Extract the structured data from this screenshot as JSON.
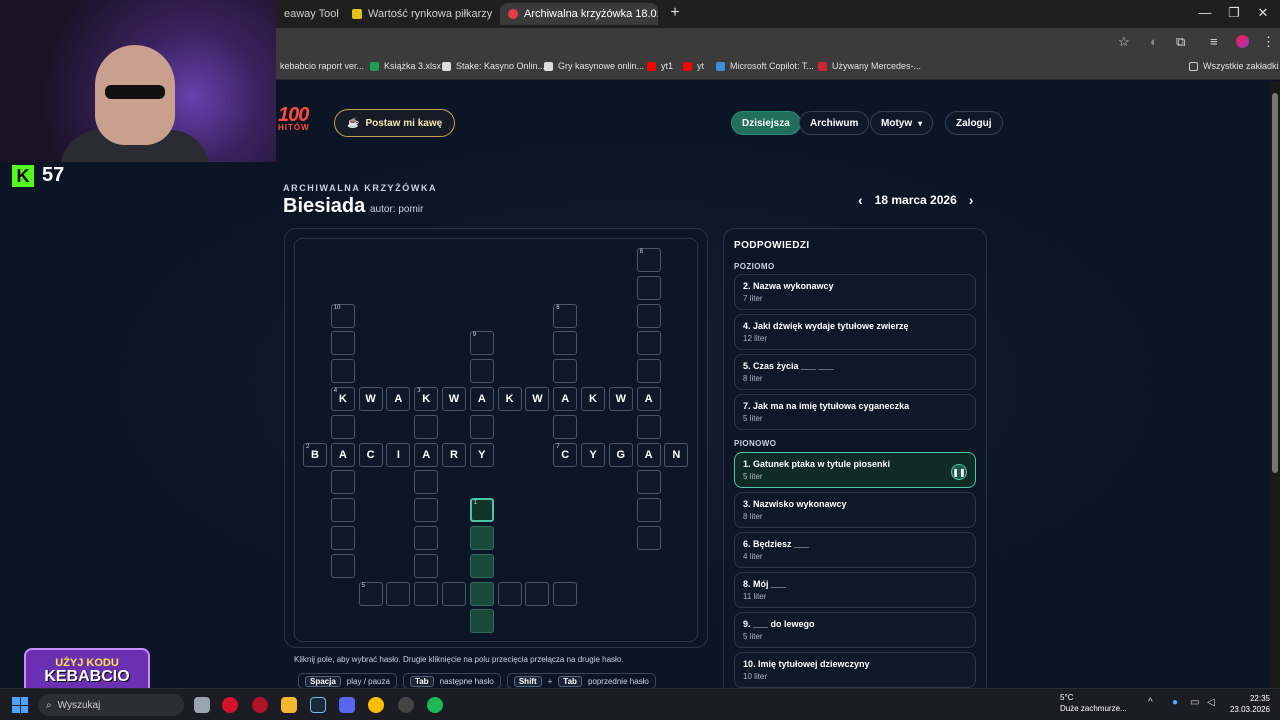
{
  "browser": {
    "tabs": [
      {
        "title": "eaway Tool",
        "favicon_color": "#3a7bd5"
      },
      {
        "title": "Wartość rynkowa piłkarzy - Qu",
        "favicon_color": "#e0c21a"
      },
      {
        "title": "Archiwalna krzyżówka 18.0:",
        "favicon_color": "#e83a4a"
      }
    ],
    "new_tab_label": "+",
    "close_glyph": "×",
    "bookmarks": [
      {
        "label": "kebabcio raport ver...",
        "color": "#4a90e2"
      },
      {
        "label": "Książka 3.xlsx",
        "color": "#1f9d55"
      },
      {
        "label": "Stake: Kasyno Onlin...",
        "color": "#ffffff"
      },
      {
        "label": "Gry kasynowe onlin...",
        "color": "#ffffff"
      },
      {
        "label": "yt1",
        "color": "#ff0000"
      },
      {
        "label": "yt",
        "color": "#ff0000"
      },
      {
        "label": "Microsoft Copilot: T...",
        "color": "#3c8dde"
      },
      {
        "label": "Używany Mercedes-...",
        "color": "#cc2233"
      }
    ],
    "all_bookmarks": "Wszystkie zakładki"
  },
  "stream": {
    "kick_count": "57",
    "promo_line1": "UŻYJ KODU",
    "promo_line2": "KEBABCIO"
  },
  "site": {
    "logo_main": "100",
    "logo_sub": "HITÓW",
    "coffee_label": "Postaw mi kawę",
    "coffee_icon": "☕",
    "nav": {
      "today": "Dzisiejsza",
      "archive": "Archiwum",
      "theme": "Motyw",
      "login": "Zaloguj"
    }
  },
  "puzzle": {
    "eyebrow": "ARCHIWALNA KRZYŻÓWKA",
    "title": "Biesiada",
    "author": "autor: pomir",
    "date": "18 marca 2026",
    "prev": "‹",
    "next": "›",
    "help_text": "Kliknij pole, aby wybrać hasło. Drugie kliknięcie na polu przecięcia przełącza na drugie hasło.",
    "keys": [
      {
        "keys": [
          "Spacja"
        ],
        "label": "play / pauza"
      },
      {
        "keys": [
          "Tab"
        ],
        "label": "następne hasło"
      },
      {
        "keys": [
          "Shift",
          "Tab"
        ],
        "label": "poprzednie hasło"
      }
    ]
  },
  "clues": {
    "title": "PODPOWIEDZI",
    "across_label": "POZIOMO",
    "down_label": "PIONOWO",
    "across": [
      {
        "text": "2. Nazwa wykonawcy",
        "len": "7 liter"
      },
      {
        "text": "4. Jaki dźwięk wydaje tytułowe zwierzę",
        "len": "12 liter"
      },
      {
        "text": "5. Czas życia ___ ___",
        "len": "8 liter"
      },
      {
        "text": "7. Jak ma na imię tytułowa cyganeczka",
        "len": "5 liter"
      }
    ],
    "down": [
      {
        "text": "1. Gatunek ptaka w tytule piosenki",
        "len": "5 liter",
        "selected": true
      },
      {
        "text": "3. Nazwisko wykonawcy",
        "len": "8 liter"
      },
      {
        "text": "6. Będziesz ___",
        "len": "4 liter"
      },
      {
        "text": "8. Mój ___",
        "len": "11 liter"
      },
      {
        "text": "9. ___ do lewego",
        "len": "5 liter"
      },
      {
        "text": "10. Imię tytułowej dziewczyny",
        "len": "10 liter"
      }
    ],
    "pause_icon": "❚❚"
  },
  "taskbar": {
    "search_placeholder": "Wyszukaj",
    "weather_temp": "5°C",
    "weather_desc": "Duże zachmurze...",
    "time": "22:35",
    "date": "23.03.2026"
  }
}
